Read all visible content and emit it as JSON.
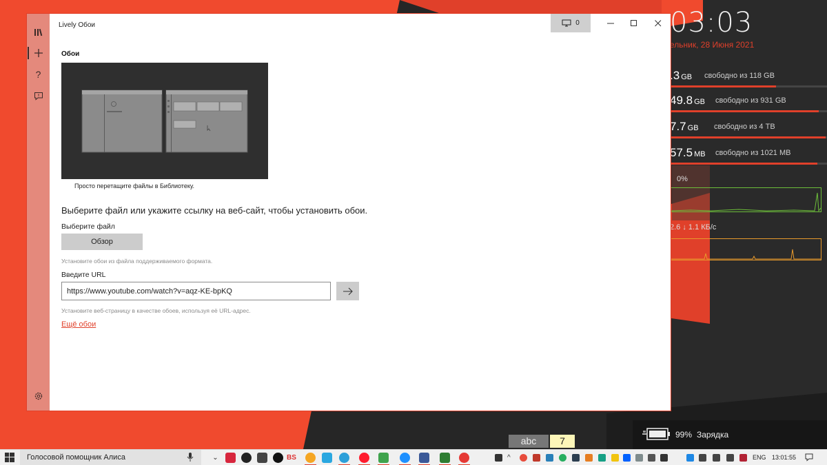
{
  "window": {
    "title": "Lively Обои",
    "monitor_count": "0"
  },
  "nav": [
    {
      "name": "library",
      "icon": "library-icon"
    },
    {
      "name": "add",
      "icon": "add-icon"
    },
    {
      "name": "help",
      "icon": "help-icon"
    },
    {
      "name": "feedback",
      "icon": "feedback-icon"
    },
    {
      "name": "settings",
      "icon": "gear-icon"
    }
  ],
  "page": {
    "heading": "Обои",
    "preview_caption": "Просто перетащите файлы в Библиотеку.",
    "prompt": "Выберите файл или укажите ссылку на веб-сайт, чтобы установить обои.",
    "file_label": "Выберите файл",
    "browse_label": "Обзор",
    "file_hint": "Установите обои из файла поддерживаемого формата.",
    "url_label": "Введите URL",
    "url_value": "https://www.youtube.com/watch?v=aqz-KE-bpKQ",
    "url_hint": "Установите веб-страницу в качестве обоев, используя её URL-адрес.",
    "more_link": "Ещё обои"
  },
  "widget": {
    "time": "03:03",
    "date": "ельник, 28 Июня 2021",
    "drives": [
      {
        "value": ".3",
        "unit": "GB",
        "free": "свободно из 118 GB",
        "fill": 0.68
      },
      {
        "value": "49.8",
        "unit": "GB",
        "free": "свободно из 931 GB",
        "fill": 0.95
      },
      {
        "value": "7.7",
        "unit": "GB",
        "free": "свободно из 4 TB",
        "fill": 0.99
      },
      {
        "value": "57.5",
        "unit": "MB",
        "free": "свободно из 1021 MB",
        "fill": 0.94
      }
    ],
    "cpu": "0%",
    "network": "2.6 ↓ 1.1 КБ/с"
  },
  "overlay": {
    "abc": "abc",
    "seven": "7",
    "battery_pct": "99%",
    "battery_label": "Зарядка"
  },
  "taskbar": {
    "search_text": "Голосовой помощник Алиса",
    "bs_label": "BS",
    "lang": "ENG",
    "time": "13:01:55"
  },
  "colors": {
    "accent": "#e0402a",
    "nav_rail": "#e4897c",
    "cpu_graph": "#6dbf3a",
    "net_graph": "#e89a2c"
  }
}
